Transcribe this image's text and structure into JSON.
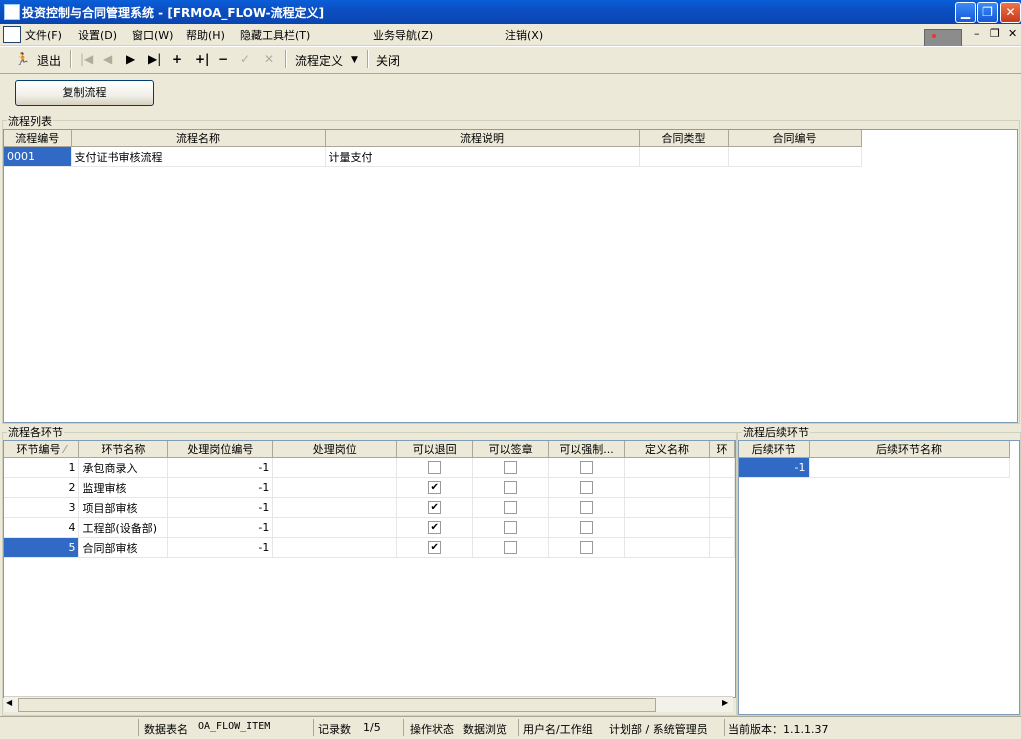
{
  "window": {
    "title": "投资控制与合同管理系统 - [FRMOA_FLOW-流程定义]"
  },
  "menu": [
    "文件(F)",
    "设置(D)",
    "窗口(W)",
    "帮助(H)",
    "隐藏工具栏(T)",
    "业务导航(Z)",
    "注销(X)"
  ],
  "toolbar": {
    "exit": "退出",
    "flow_def": "流程定义",
    "close": "关闭"
  },
  "copy_button": "复制流程",
  "flow_list": {
    "label": "流程列表",
    "columns": [
      "流程编号",
      "流程名称",
      "流程说明",
      "合同类型",
      "合同编号"
    ],
    "rows": [
      [
        "0001",
        "支付证书审核流程",
        "计量支付",
        "",
        ""
      ]
    ]
  },
  "steps": {
    "label": "流程各环节",
    "columns": [
      "环节编号",
      "环节名称",
      "处理岗位编号",
      "处理岗位",
      "可以退回",
      "可以签章",
      "可以强制...",
      "定义名称",
      "环"
    ],
    "rows": [
      {
        "no": "1",
        "name": "承包商录入",
        "post_no": "-1",
        "post": "",
        "return": false,
        "sign": false,
        "force": false
      },
      {
        "no": "2",
        "name": "监理审核",
        "post_no": "-1",
        "post": "",
        "return": true,
        "sign": false,
        "force": false
      },
      {
        "no": "3",
        "name": "项目部审核",
        "post_no": "-1",
        "post": "",
        "return": true,
        "sign": false,
        "force": false
      },
      {
        "no": "4",
        "name": "工程部(设备部)",
        "post_no": "-1",
        "post": "",
        "return": true,
        "sign": false,
        "force": false
      },
      {
        "no": "5",
        "name": "合同部审核",
        "post_no": "-1",
        "post": "",
        "return": true,
        "sign": false,
        "force": false
      }
    ]
  },
  "next_steps": {
    "label": "流程后续环节",
    "columns": [
      "后续环节",
      "后续环节名称"
    ],
    "rows": [
      [
        "-1",
        ""
      ]
    ]
  },
  "status": {
    "table_label": "数据表名",
    "table_value": "OA_FLOW_ITEM",
    "count_label": "记录数",
    "count_value": "1/5",
    "op_label": "操作状态",
    "op_value": "数据浏览",
    "user_label": "用户名/工作组",
    "user_value": "计划部 / 系统管理员",
    "version": "当前版本：1.1.1.37"
  }
}
